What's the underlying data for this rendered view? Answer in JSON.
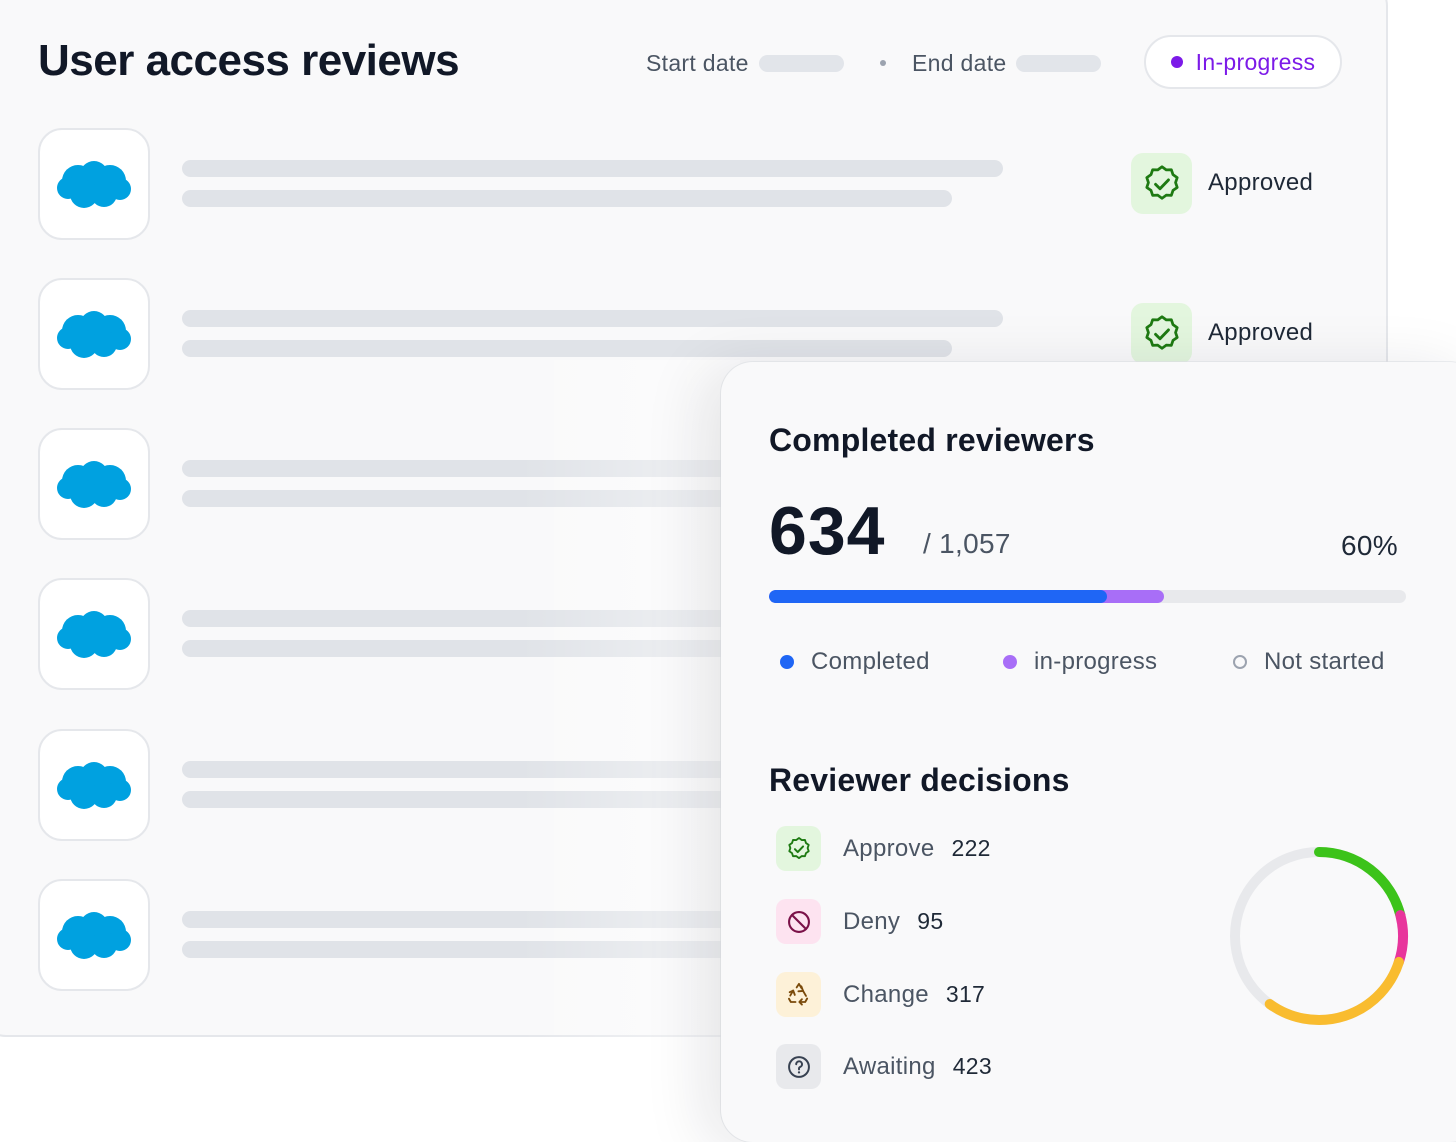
{
  "page": {
    "title": "User access reviews",
    "start_date_label": "Start date",
    "end_date_label": "End date",
    "status": "In-progress",
    "status_color": "#7C1AE8"
  },
  "reviews": [
    {
      "app_icon": "salesforce-cloud-icon",
      "status": "Approved"
    },
    {
      "app_icon": "salesforce-cloud-icon",
      "status": "Approved"
    },
    {
      "app_icon": "salesforce-cloud-icon",
      "status": ""
    },
    {
      "app_icon": "salesforce-cloud-icon",
      "status": ""
    },
    {
      "app_icon": "salesforce-cloud-icon",
      "status": ""
    },
    {
      "app_icon": "salesforce-cloud-icon",
      "status": ""
    }
  ],
  "completed_reviewers": {
    "title": "Completed reviewers",
    "completed": "634",
    "total": "/ 1,057",
    "percent": "60%",
    "progress": {
      "completed_fraction": 0.53,
      "in_progress_fraction": 0.09
    },
    "legend": [
      {
        "label": "Completed",
        "color": "#1F66F5"
      },
      {
        "label": "in-progress",
        "color": "#A86EF7"
      },
      {
        "label": "Not started",
        "color": "#E8E9EC"
      }
    ]
  },
  "reviewer_decisions": {
    "title": "Reviewer decisions",
    "items": [
      {
        "label": "Approve",
        "count": "222",
        "icon": "check-badge-icon",
        "color": "#3CC31A"
      },
      {
        "label": "Deny",
        "count": "95",
        "icon": "prohibited-icon",
        "color": "#E8359C"
      },
      {
        "label": "Change",
        "count": "317",
        "icon": "recycle-icon",
        "color": "#F9BC2F"
      },
      {
        "label": "Awaiting",
        "count": "423",
        "icon": "question-circle-icon",
        "color": "#E8E9EC"
      }
    ]
  },
  "chart_data": {
    "type": "pie",
    "style": "donut",
    "categories": [
      "Approve",
      "Deny",
      "Change",
      "Awaiting"
    ],
    "values": [
      222,
      95,
      317,
      423
    ],
    "colors": [
      "#3CC31A",
      "#E8359C",
      "#F9BC2F",
      "#E8E9EC"
    ],
    "title": ""
  }
}
